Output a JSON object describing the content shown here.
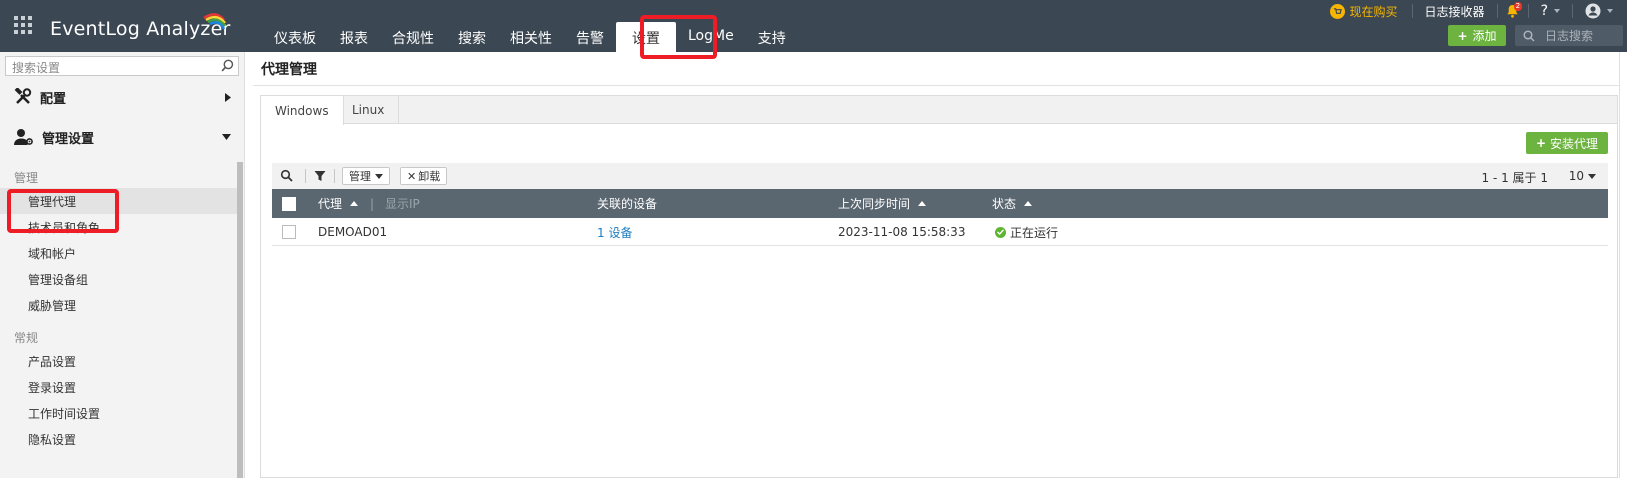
{
  "app": {
    "name": "EventLog Analyzer"
  },
  "nav": {
    "items": [
      "仪表板",
      "报表",
      "合规性",
      "搜索",
      "相关性",
      "告警",
      "设置",
      "LogMe",
      "支持"
    ],
    "active": "设置"
  },
  "top_right": {
    "buy_now": "现在购买",
    "log_receiver": "日志接收器",
    "notification_count": "2",
    "help": "?",
    "add_label": "添加",
    "log_search_placeholder": "日志搜索"
  },
  "sidebar": {
    "search_placeholder": "搜索设置",
    "groups": [
      {
        "label": "配置",
        "expanded": false
      },
      {
        "label": "管理设置",
        "expanded": true
      }
    ],
    "sections": [
      {
        "title": "管理",
        "items": [
          "管理代理",
          "技术员和角色",
          "域和帐户",
          "管理设备组",
          "威胁管理"
        ]
      },
      {
        "title": "常规",
        "items": [
          "产品设置",
          "登录设置",
          "工作时间设置",
          "隐私设置"
        ]
      }
    ],
    "active_item": "管理代理"
  },
  "main": {
    "page_title": "代理管理",
    "tabs": [
      "Windows",
      "Linux"
    ],
    "active_tab": "Windows",
    "install_agent_label": "安装代理",
    "toolbar": {
      "manage_label": "管理",
      "uninstall_label": "卸载"
    },
    "pager": {
      "range": "1 - 1 属于 1",
      "page_size": "10"
    },
    "table": {
      "columns": {
        "agent": "代理",
        "show_ip": "显示IP",
        "devices": "关联的设备",
        "last_sync": "上次同步时间",
        "status": "状态"
      },
      "rows": [
        {
          "agent": "DEMOAD01",
          "devices": "1 设备",
          "last_sync": "2023-11-08 15:58:33",
          "status": "正在运行"
        }
      ]
    }
  },
  "colors": {
    "topbar": "#3b4752",
    "accent_green": "#6cb33f",
    "highlight_red": "#ee1c25",
    "link_blue": "#1c7dc2",
    "table_header": "#5b6770",
    "buy_orange": "#f7b500"
  }
}
